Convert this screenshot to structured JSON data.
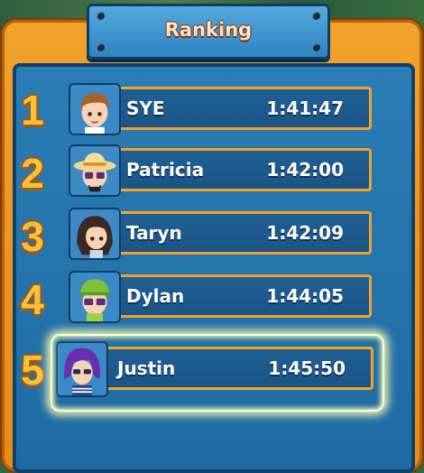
{
  "title": "Ranking",
  "rows": [
    {
      "rank": "1",
      "name": "SYE",
      "time": "1:41:47",
      "avatar_icon": "avatar-brown-hair-boy-icon"
    },
    {
      "rank": "2",
      "name": "Patricia",
      "time": "1:42:00",
      "avatar_icon": "avatar-straw-hat-icon"
    },
    {
      "rank": "3",
      "name": "Taryn",
      "time": "1:42:09",
      "avatar_icon": "avatar-dark-hair-girl-icon"
    },
    {
      "rank": "4",
      "name": "Dylan",
      "time": "1:44:05",
      "avatar_icon": "avatar-green-cap-icon"
    },
    {
      "rank": "5",
      "name": "Justin",
      "time": "1:45:50",
      "avatar_icon": "avatar-purple-hair-icon"
    }
  ],
  "highlighted_rank": "5",
  "colors": {
    "board_orange": "#f0a22b",
    "panel_blue": "#2b7db5",
    "rank_gold": "#f7c23e",
    "highlight_glow": "#f2f7b0"
  }
}
